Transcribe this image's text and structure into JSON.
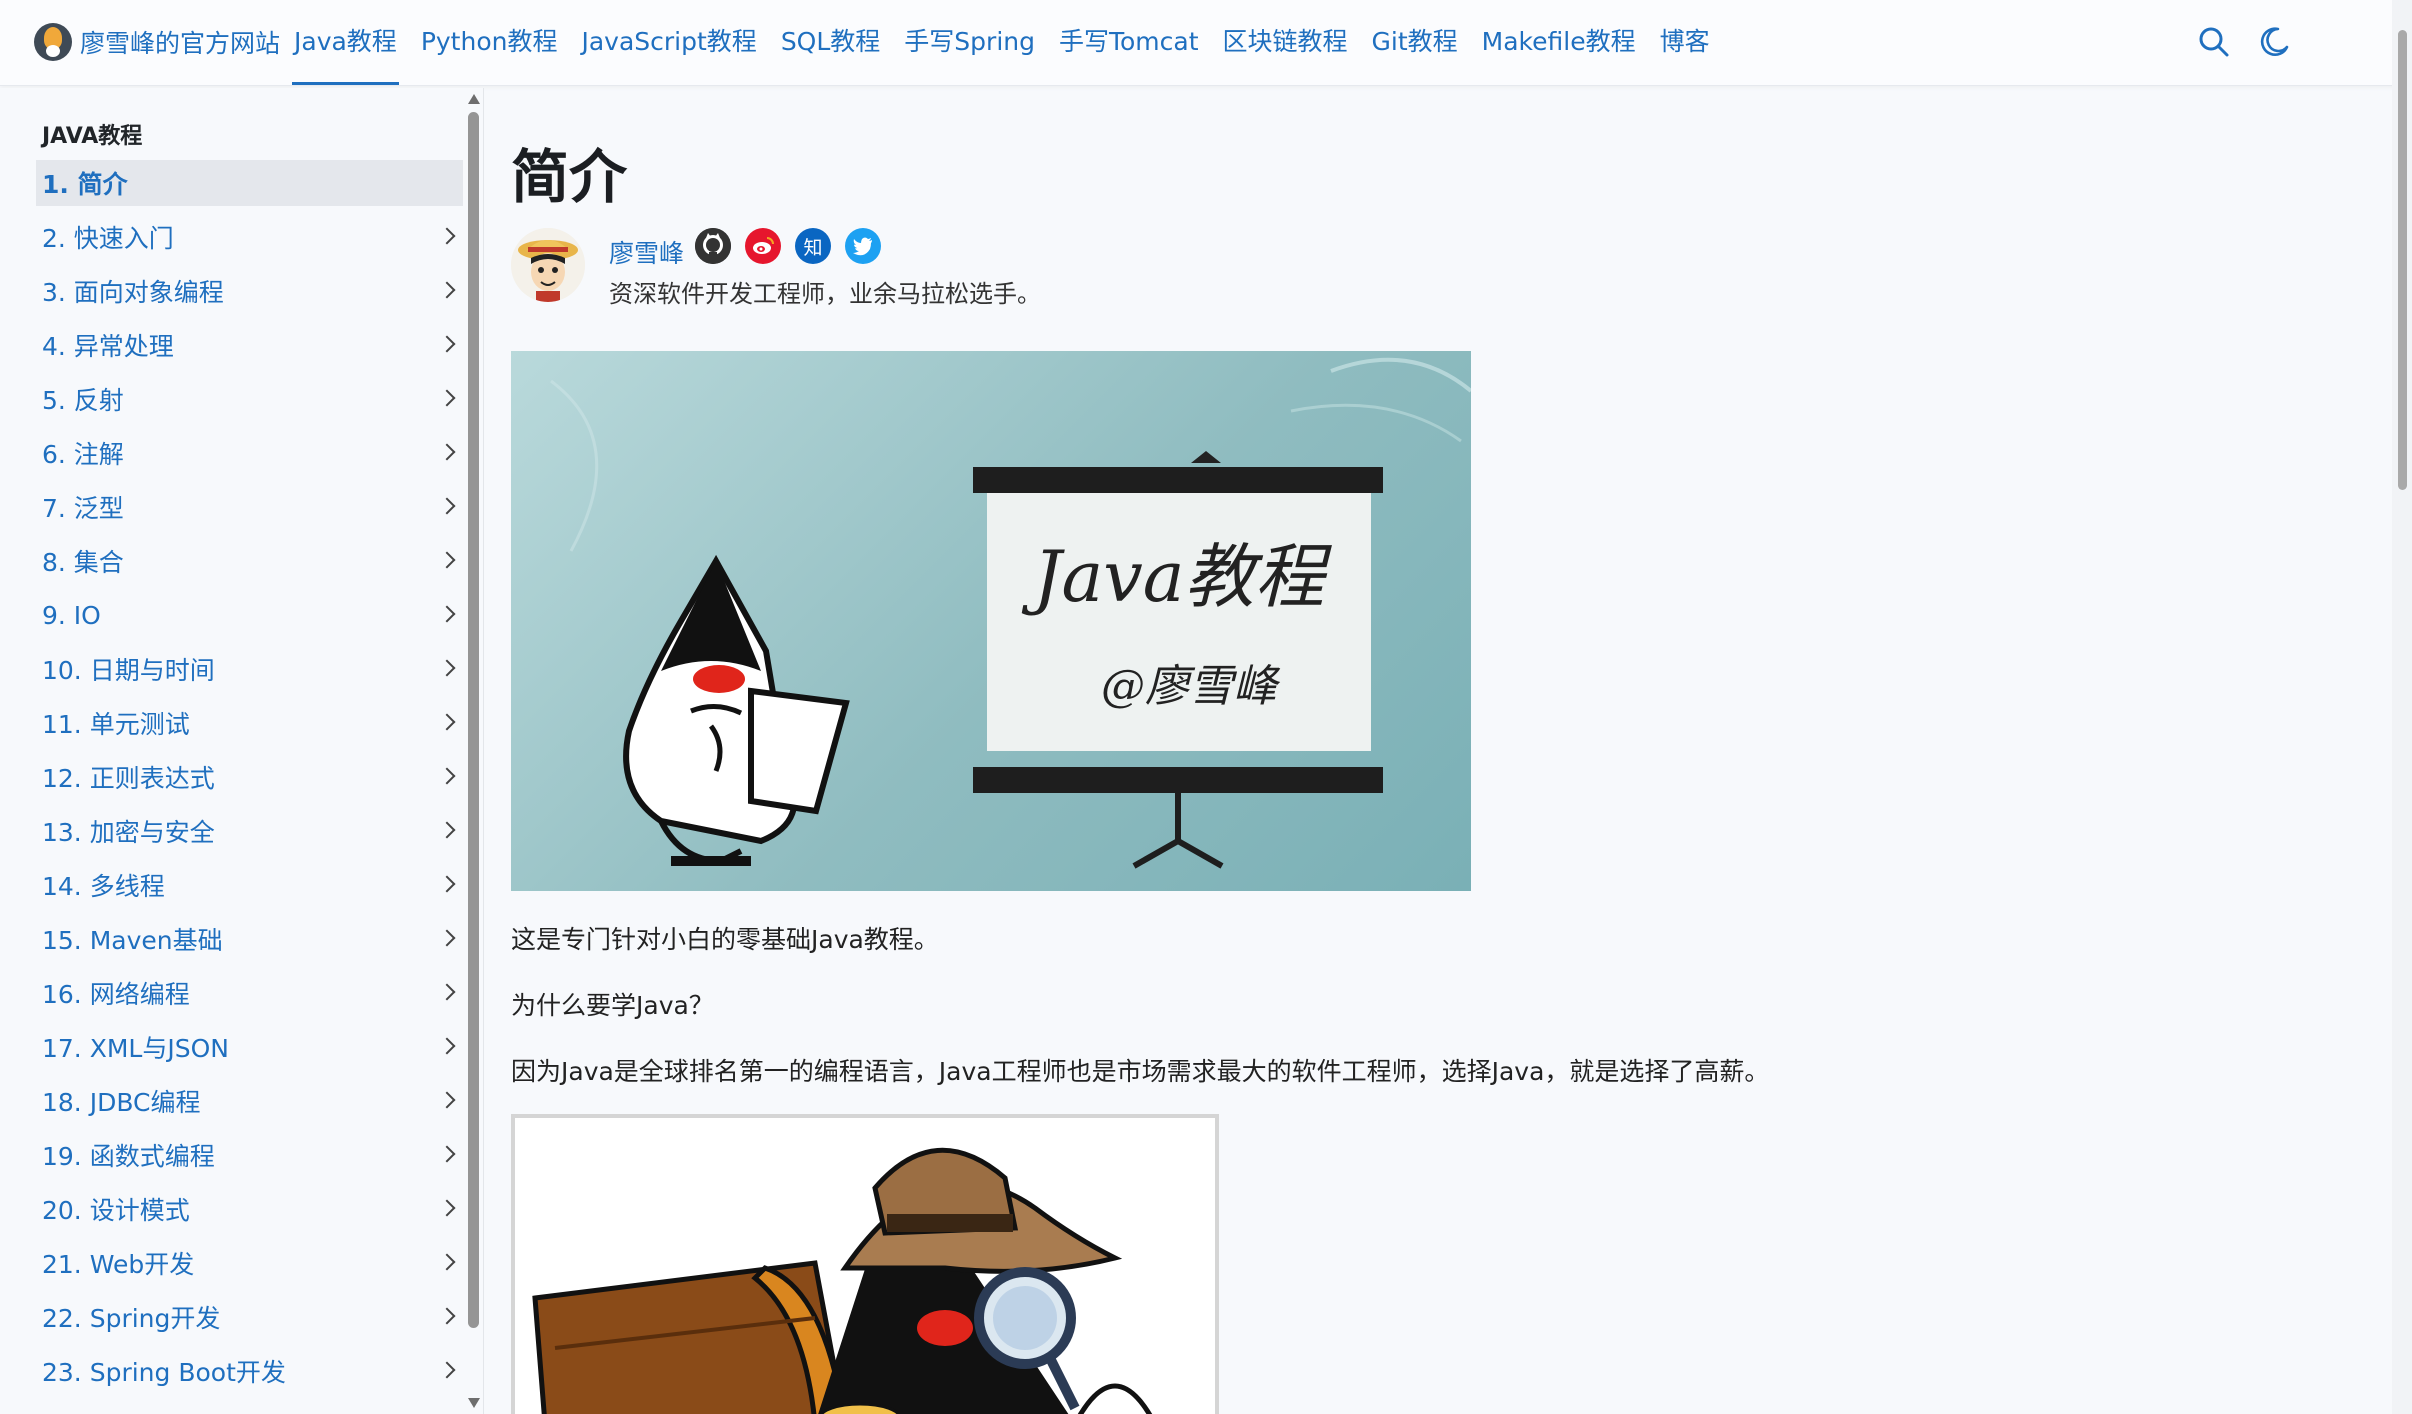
{
  "nav": {
    "brand": "廖雪峰的官方网站",
    "links": [
      {
        "label": "Java教程",
        "active": true
      },
      {
        "label": "Python教程",
        "active": false
      },
      {
        "label": "JavaScript教程",
        "active": false
      },
      {
        "label": "SQL教程",
        "active": false
      },
      {
        "label": "手写Spring",
        "active": false
      },
      {
        "label": "手写Tomcat",
        "active": false
      },
      {
        "label": "区块链教程",
        "active": false
      },
      {
        "label": "Git教程",
        "active": false
      },
      {
        "label": "Makefile教程",
        "active": false
      },
      {
        "label": "博客",
        "active": false
      }
    ],
    "icons": [
      "search-icon",
      "moon-icon"
    ]
  },
  "sidebar": {
    "heading": "JAVA教程",
    "items": [
      {
        "label": "1. 简介",
        "active": true,
        "has_children": false
      },
      {
        "label": "2. 快速入门",
        "has_children": true
      },
      {
        "label": "3. 面向对象编程",
        "has_children": true
      },
      {
        "label": "4. 异常处理",
        "has_children": true
      },
      {
        "label": "5. 反射",
        "has_children": true
      },
      {
        "label": "6. 注解",
        "has_children": true
      },
      {
        "label": "7. 泛型",
        "has_children": true
      },
      {
        "label": "8. 集合",
        "has_children": true
      },
      {
        "label": "9. IO",
        "has_children": true
      },
      {
        "label": "10. 日期与时间",
        "has_children": true
      },
      {
        "label": "11. 单元测试",
        "has_children": true
      },
      {
        "label": "12. 正则表达式",
        "has_children": true
      },
      {
        "label": "13. 加密与安全",
        "has_children": true
      },
      {
        "label": "14. 多线程",
        "has_children": true
      },
      {
        "label": "15. Maven基础",
        "has_children": true
      },
      {
        "label": "16. 网络编程",
        "has_children": true
      },
      {
        "label": "17. XML与JSON",
        "has_children": true
      },
      {
        "label": "18. JDBC编程",
        "has_children": true
      },
      {
        "label": "19. 函数式编程",
        "has_children": true
      },
      {
        "label": "20. 设计模式",
        "has_children": true
      },
      {
        "label": "21. Web开发",
        "has_children": true
      },
      {
        "label": "22. Spring开发",
        "has_children": true
      },
      {
        "label": "23. Spring Boot开发",
        "has_children": true
      }
    ]
  },
  "article": {
    "title": "简介",
    "author": {
      "name": "廖雪峰",
      "bio": "资深软件开发工程师，业余马拉松选手。",
      "social": [
        {
          "name": "github-icon",
          "color": "#333333",
          "glyph": ""
        },
        {
          "name": "weibo-icon",
          "color": "#e6162d",
          "glyph": ""
        },
        {
          "name": "zhihu-icon",
          "color": "#0a66c2",
          "glyph": "知"
        },
        {
          "name": "twitter-icon",
          "color": "#1da1f2",
          "glyph": ""
        }
      ]
    },
    "hero": {
      "board_title": "Java教程",
      "board_sub": "@廖雪峰"
    },
    "paragraphs": [
      "这是专门针对小白的零基础Java教程。",
      "为什么要学Java？",
      "因为Java是全球排名第一的编程语言，Java工程师也是市场需求最大的软件工程师，选择Java，就是选择了高薪。"
    ]
  },
  "colors": {
    "link": "#1f6fbf",
    "active_bg": "#e4e7ec"
  }
}
